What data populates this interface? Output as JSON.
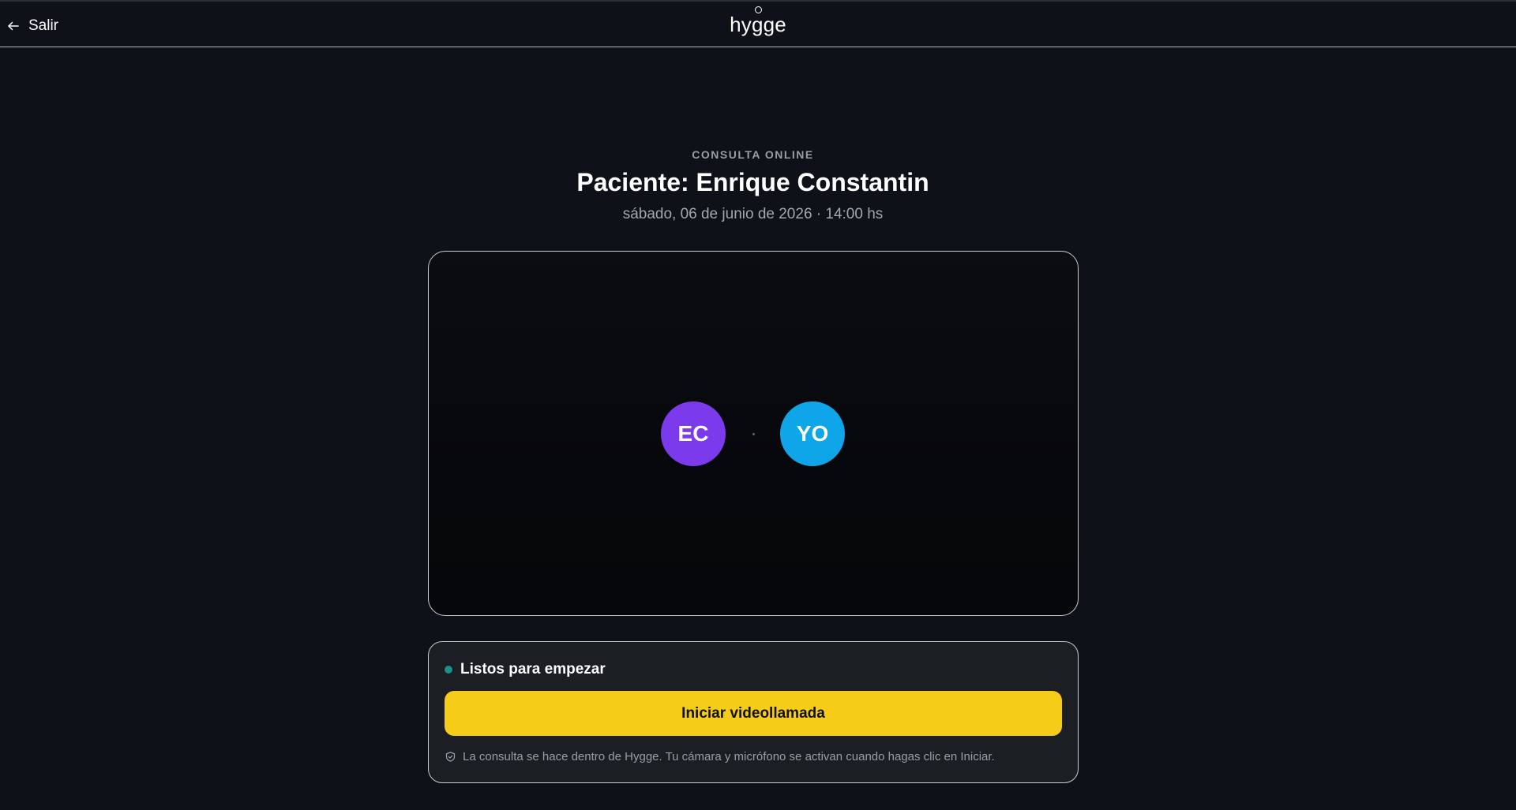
{
  "topbar": {
    "back_label": "Salir",
    "logo_text": "hygge"
  },
  "header": {
    "eyebrow": "CONSULTA ONLINE",
    "title": "Paciente: Enrique Constantin",
    "subtitle": "sábado, 06 de junio de 2026 · 14:00 hs"
  },
  "video": {
    "participants": [
      {
        "initials": "EC",
        "color": "#7c3aed"
      },
      {
        "initials": "YO",
        "color": "#0ea5e9"
      }
    ]
  },
  "panel": {
    "status_text": "Listos para empezar",
    "status_color": "#1e8f8a",
    "start_button_label": "Iniciar videollamada",
    "button_color": "#f5cc17",
    "note_icon": "shield-check-icon",
    "note_text": "La consulta se hace dentro de Hygge. Tu cámara y micrófono se activan cuando hagas clic en Iniciar."
  }
}
